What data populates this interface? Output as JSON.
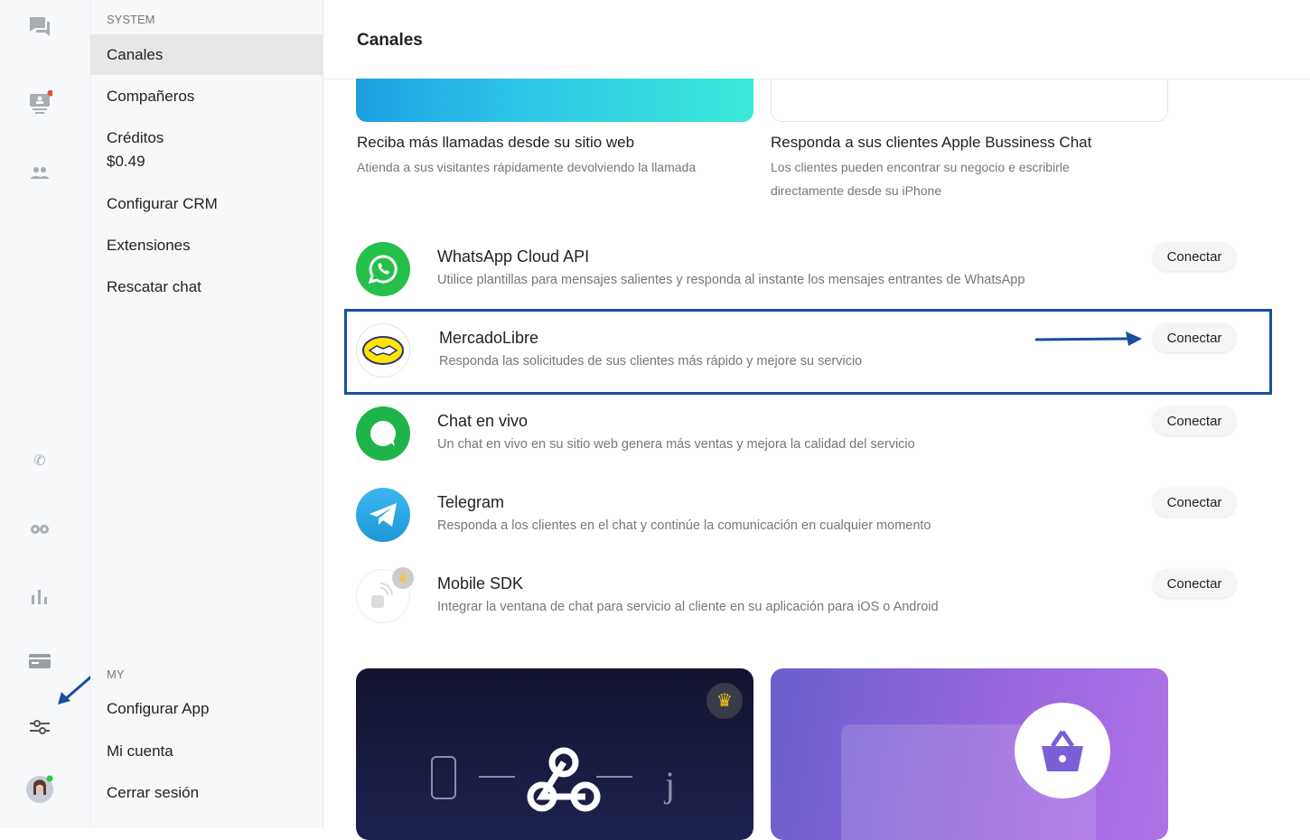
{
  "sidebar": {
    "system_label": "SYSTEM",
    "items": [
      {
        "label": "Canales"
      },
      {
        "label": "Compañeros"
      },
      {
        "label": "Créditos",
        "value": "$0.49"
      },
      {
        "label": "Configurar CRM"
      },
      {
        "label": "Extensiones"
      },
      {
        "label": "Rescatar chat"
      }
    ],
    "my_label": "MY",
    "my_items": [
      {
        "label": "Configurar App"
      },
      {
        "label": "Mi cuenta"
      },
      {
        "label": "Cerrar sesión"
      }
    ]
  },
  "header": {
    "title": "Canales"
  },
  "promos": [
    {
      "title": "Reciba más llamadas desde su sitio web",
      "desc": "Atienda a sus visitantes rápidamente devolviendo la llamada"
    },
    {
      "title": "Responda a sus clientes Apple Bussiness Chat",
      "desc": "Los clientes pueden encontrar su negocio e escribirle directamente desde su iPhone"
    }
  ],
  "channels": [
    {
      "name": "WhatsApp Cloud API",
      "desc": "Utilice plantillas para mensajes salientes y responda al instante los mensajes entrantes de WhatsApp",
      "button": "Conectar",
      "color": "#25c04a"
    },
    {
      "name": "MercadoLibre",
      "desc": "Responda las solicitudes de sus clientes más rápido y mejore su servicio",
      "button": "Conectar",
      "color": "#ffe600"
    },
    {
      "name": "Chat en vivo",
      "desc": "Un chat en vivo en su sitio web genera más ventas y mejora la calidad del servicio",
      "button": "Conectar",
      "color": "#1fb44a"
    },
    {
      "name": "Telegram",
      "desc": "Responda a los clientes en el chat y continúe la comunicación en cualquier momento",
      "button": "Conectar",
      "color": "#2aa3e0"
    },
    {
      "name": "Mobile SDK",
      "desc": "Integrar la ventana de chat para servicio al cliente en su aplicación para iOS o Android",
      "button": "Conectar",
      "color": "#eeeeee"
    }
  ],
  "colors": {
    "highlight": "#1a4fa0",
    "accent": "#2d6fd6"
  }
}
